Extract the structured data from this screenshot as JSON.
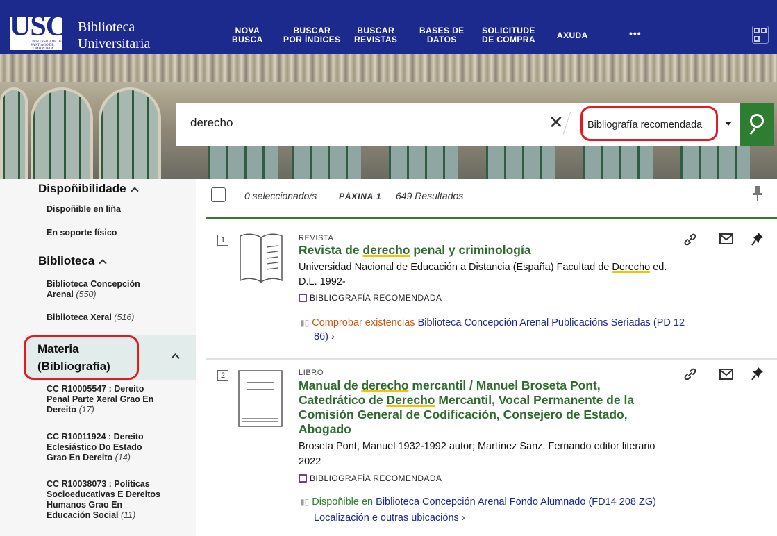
{
  "header": {
    "logo": "USC",
    "logo_sub": "UNIVERSIDADE DE SANTIAGO DE COMPOSTELA",
    "brand_line1": "Biblioteca",
    "brand_line2": "Universitaria",
    "nav": [
      {
        "l1": "NOVA",
        "l2": "BUSCA"
      },
      {
        "l1": "BUSCAR",
        "l2": "POR ÍNDICES"
      },
      {
        "l1": "BUSCAR",
        "l2": "REVISTAS"
      },
      {
        "l1": "BASES DE",
        "l2": "DATOS"
      },
      {
        "l1": "SOLICITUDE",
        "l2": "DE COMPRA"
      },
      {
        "l1": "AXUDA",
        "l2": ""
      }
    ],
    "more": "•••",
    "qr_icon": "qr-code-icon"
  },
  "search": {
    "query": "derecho",
    "clear_glyph": "✕",
    "scope": "Bibliografía recomendada",
    "button_icon": "search-icon"
  },
  "sidebar": {
    "availability": {
      "title": "Dispoñibilidade",
      "items": [
        "Dispoñible en liña",
        "En soporte físico"
      ]
    },
    "library": {
      "title": "Biblioteca",
      "items": [
        {
          "label": "Biblioteca Concepción Arenal",
          "count": "(550)"
        },
        {
          "label": "Biblioteca Xeral",
          "count": "(516)"
        }
      ]
    },
    "subject": {
      "title_l1": "Materia",
      "title_l2": "(Bibliografía)",
      "items": [
        {
          "label": "CC R10005547 : Dereito Penal Parte Xeral Grao En Dereito",
          "count": "(17)"
        },
        {
          "label": "CC R10011924 : Dereito Eclesiástico Do Estado Grao En Dereito",
          "count": "(14)"
        },
        {
          "label": "CC R10038073 : Políticas Socioeducativas E Dereitos Humanos Grao En Educación Social",
          "count": "(11)"
        }
      ]
    }
  },
  "results_header": {
    "selected": "0 seleccionado/s",
    "page": "PÁXINA 1",
    "count": "649 Resultados"
  },
  "results": [
    {
      "number": "1",
      "type": "REVISTA",
      "title_pre": "Revista de ",
      "title_hl": "derecho",
      "title_post": " penal y criminología",
      "meta_pre": "Universidad Nacional de Educación a Distancia (España) Facultad de ",
      "meta_hl": "Derecho",
      "meta_post": " ed.",
      "date": "D.L. 1992-",
      "badge": "BIBLIOGRAFÍA RECOMENDADA",
      "avail_status": "Comprobar existencias",
      "avail_location": "Biblioteca Concepción Arenal  Publicacións Seriadas (PD 12",
      "avail_location2": "86)",
      "chevron": "›"
    },
    {
      "number": "2",
      "type": "LIBRO",
      "title_l1_pre": "Manual de ",
      "title_l1_hl": "derecho",
      "title_l1_post": " mercantil / Manuel Broseta Pont,",
      "title_l2_pre": "Catedrático de ",
      "title_l2_hl": "Derecho",
      "title_l2_post": " Mercantil, Vocal Permanente de la",
      "title_l3": "Comisión General de Codificación, Consejero de Estado,",
      "title_l4": "Abogado",
      "meta": "Broseta Pont, Manuel 1932-1992 autor; Martínez Sanz, Fernando editor literario",
      "date": "2022",
      "badge": "BIBLIOGRAFÍA RECOMENDADA",
      "avail_status": "Dispoñible en",
      "avail_location": "Biblioteca Concepción Arenal  Fondo Alumnado (FD14 208 ZG)",
      "more_locations": "Localización e outras ubicacións",
      "chevron": "›"
    }
  ],
  "icons": {
    "link": "link-icon",
    "email": "email-icon",
    "pin": "pin-icon"
  },
  "colors": {
    "header_bg": "#1c2a8e",
    "accent_green": "#2e7d32",
    "title_green": "#2e6b2f",
    "highlight_red": "#e01b24"
  }
}
